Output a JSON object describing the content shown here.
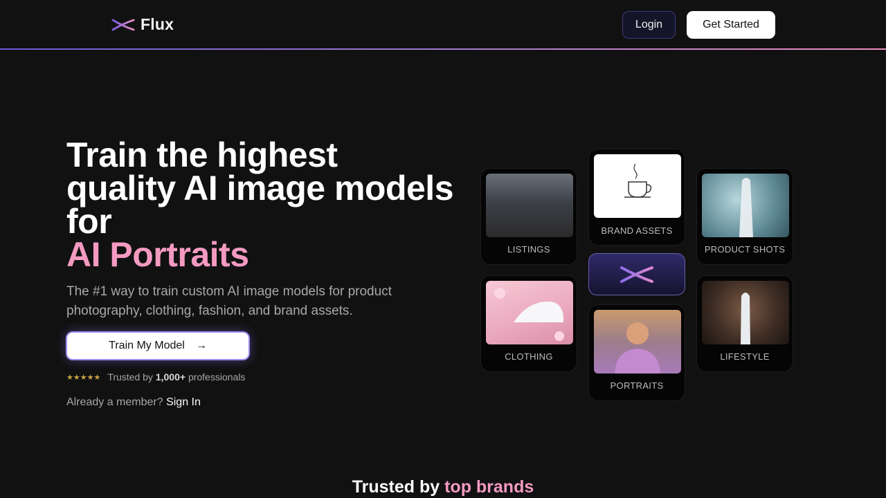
{
  "header": {
    "logo_text": "Flux",
    "login_label": "Login",
    "get_started_label": "Get Started"
  },
  "hero": {
    "title_main": "Train the highest quality AI image models for",
    "title_accent": "AI Portraits",
    "subtitle": "The #1 way to train custom AI image models for product photography, clothing, fashion, and brand assets.",
    "cta_label": "Train My Model",
    "cta_icon": "arrow-right-icon",
    "stars": "★★★★★",
    "trusted_prefix": "Trusted by",
    "trusted_count": "1,000+",
    "trusted_suffix": "professionals",
    "member_prompt": "Already a member?",
    "signin_label": "Sign In"
  },
  "cards": {
    "listings": "LISTINGS",
    "brand_assets": "BRAND ASSETS",
    "product_shots": "PRODUCT SHOTS",
    "clothing": "CLOTHING",
    "portraits": "PORTRAITS",
    "lifestyle": "LIFESTYLE"
  },
  "brands": {
    "title_main": "Trusted by",
    "title_accent": "top brands"
  },
  "colors": {
    "background": "#111111",
    "accent_pink": "#f49ac1",
    "accent_purple": "#6b5bd6"
  }
}
